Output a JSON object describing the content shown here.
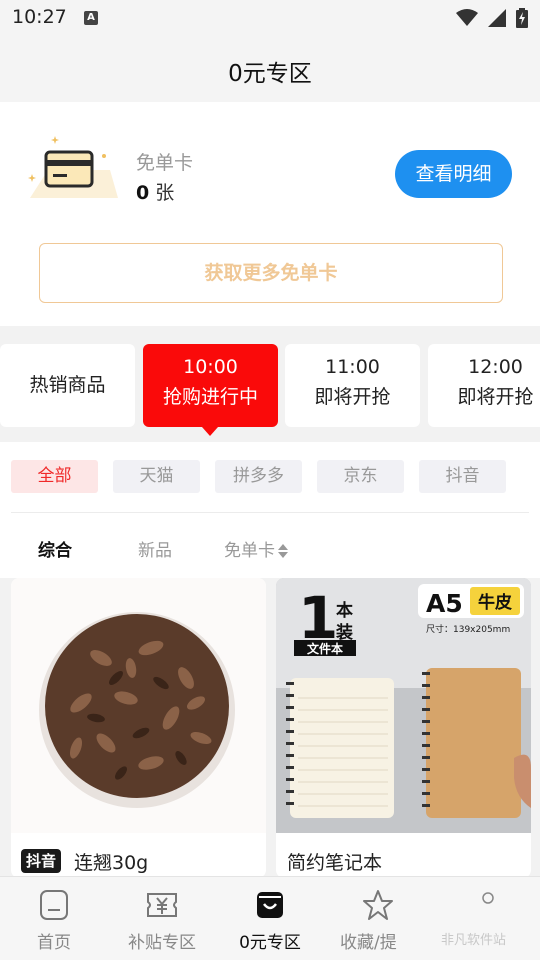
{
  "status_bar": {
    "time": "10:27",
    "notification_letter": "A"
  },
  "header": {
    "title": "0元专区"
  },
  "card": {
    "name": "免单卡",
    "count": "0",
    "unit": "张",
    "detail_button": "查看明细",
    "get_more_button": "获取更多免单卡"
  },
  "slots": [
    {
      "label": "热销商品"
    },
    {
      "time": "10:00",
      "status": "抢购进行中"
    },
    {
      "time": "11:00",
      "status": "即将开抢"
    },
    {
      "time": "12:00",
      "status": "即将开抢"
    }
  ],
  "platforms": [
    "全部",
    "天猫",
    "拼多多",
    "京东",
    "抖音"
  ],
  "sort": [
    "综合",
    "新品",
    "免单卡"
  ],
  "products": [
    {
      "platform_tag": "抖音",
      "title": "连翘30g"
    },
    {
      "title": "简约笔记本",
      "image_text": {
        "big_num": "1",
        "ben": "本",
        "zhuang": "装",
        "label": "文件本",
        "size": "A5",
        "material": "牛皮",
        "dims": "尺寸：139x205mm"
      }
    }
  ],
  "bottom_nav": [
    {
      "label": "首页",
      "icon": "home-icon"
    },
    {
      "label": "补贴专区",
      "icon": "subsidy-icon"
    },
    {
      "label": "0元专区",
      "icon": "bag-icon",
      "active": true
    },
    {
      "label": "收藏/提",
      "icon": "star-icon"
    }
  ],
  "watermark": "非凡软件站",
  "colors": {
    "accent_red": "#fa0a0a",
    "accent_blue": "#1e90f0",
    "gold": "#f0c896"
  }
}
